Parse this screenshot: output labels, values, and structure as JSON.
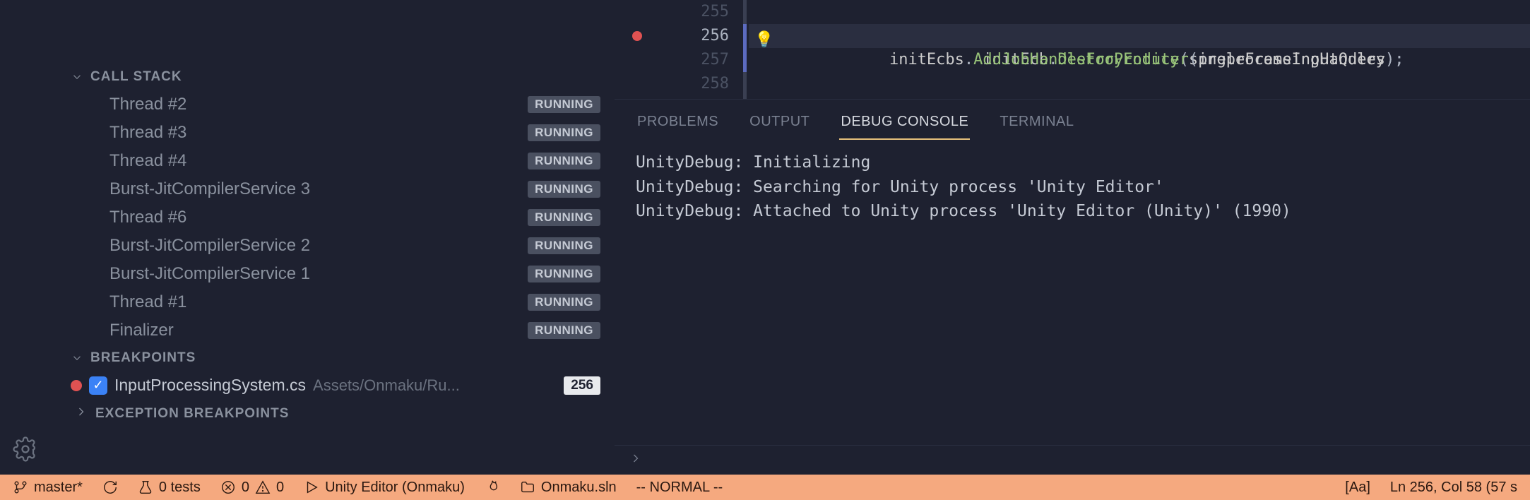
{
  "sidebar": {
    "callstack_label": "CALL STACK",
    "threads": [
      {
        "name": "Thread #2",
        "status": "RUNNING"
      },
      {
        "name": "Thread #3",
        "status": "RUNNING"
      },
      {
        "name": "Thread #4",
        "status": "RUNNING"
      },
      {
        "name": "Burst-JitCompilerService 3",
        "status": "RUNNING"
      },
      {
        "name": "Thread #6",
        "status": "RUNNING"
      },
      {
        "name": "Burst-JitCompilerService 2",
        "status": "RUNNING"
      },
      {
        "name": "Burst-JitCompilerService 1",
        "status": "RUNNING"
      },
      {
        "name": "Thread #1",
        "status": "RUNNING"
      },
      {
        "name": "Finalizer",
        "status": "RUNNING"
      }
    ],
    "breakpoints_label": "BREAKPOINTS",
    "breakpoint": {
      "file": "InputProcessingSystem.cs",
      "path": "Assets/Onmaku/Ru...",
      "line": "256"
    },
    "exception_bp_label": "EXCEPTION BREAKPOINTS"
  },
  "editor": {
    "lines": [
      "255",
      "256",
      "257",
      "258"
    ],
    "active_line": "256",
    "code256": {
      "a": "initEcb",
      "d": ".",
      "m": "DestroyEntity",
      "p1": "(",
      "arg": "singleFrameInputQuery",
      "p2": ");"
    },
    "code257": {
      "a": "initEcbs",
      "d": ".",
      "m": "AddJobHandleForProducer",
      "p1": "(",
      "arg": "preprocessingHandles",
      "p2": ");"
    }
  },
  "panel": {
    "tabs": [
      "PROBLEMS",
      "OUTPUT",
      "DEBUG CONSOLE",
      "TERMINAL"
    ],
    "active_tab": "DEBUG CONSOLE",
    "console_lines": [
      "UnityDebug: Initializing",
      "UnityDebug: Searching for Unity process 'Unity Editor'",
      "UnityDebug: Attached to Unity process 'Unity Editor (Unity)' (1990)"
    ]
  },
  "statusbar": {
    "branch": "master*",
    "tests": "0 tests",
    "errors": "0",
    "warnings": "0",
    "debug_target": "Unity Editor (Onmaku)",
    "solution": "Onmaku.sln",
    "vim_mode": "-- NORMAL --",
    "case": "[Aa]",
    "position": "Ln 256, Col 58 (57 s"
  }
}
